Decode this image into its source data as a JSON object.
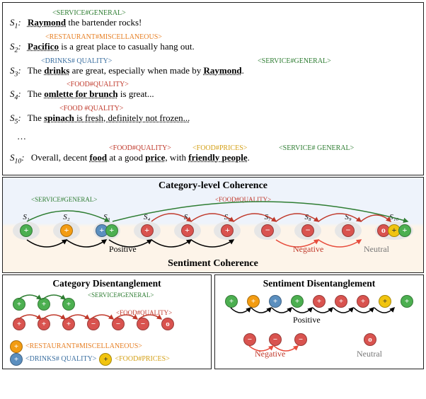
{
  "tags": {
    "service_general": "<SERVICE#GENERAL>",
    "restaurant_misc": "<RESTAURANT#MISCELLANEOUS>",
    "drinks_quality": "<DRINKS# QUALITY>",
    "food_quality": "<FOOD#QUALITY>",
    "food_quality_sp": "<FOOD #QUALITY>",
    "food_prices": "<FOOD#PRICES>",
    "service_general_sp": "<SERVICE# GENERAL>"
  },
  "sentences": {
    "s1": {
      "idx": "S",
      "sub": "1",
      "pre": "",
      "aspect": "Raymond",
      "post": " the bartender rocks!"
    },
    "s2": {
      "idx": "S",
      "sub": "2",
      "pre": "",
      "aspect": "Pacifico",
      "post": " is a great place to casually hang out."
    },
    "s3": {
      "idx": "S",
      "sub": "3",
      "pre": "The ",
      "aspect": "drinks",
      "post": " are great, especially when made by ",
      "aspect2": "Raymond",
      "post2": "."
    },
    "s4": {
      "idx": "S",
      "sub": "4",
      "pre": "The ",
      "aspect": "omlette for brunch",
      "post": " is great..."
    },
    "s5": {
      "idx": "S",
      "sub": "5",
      "pre": "The ",
      "aspect": "spinach",
      "post": " is fresh, definitely not frozen..."
    },
    "ell": "…",
    "s10": {
      "idx": "S",
      "sub": "10",
      "pre": "Overall, decent ",
      "aspect": "food",
      "mid1": " at a good ",
      "aspect2": "price",
      "mid2": ", with ",
      "aspect3": "friendly people",
      "post": "."
    }
  },
  "panel2": {
    "title_top": "Category-level Coherence",
    "title_bottom": "Sentiment Coherence",
    "tag_service": "<SERVICE#GENERAL>",
    "tag_food": "<FOOD#QUALITY>",
    "pos": "Positive",
    "neg": "Negative",
    "neu": "Neutral",
    "nodes": [
      "S₁",
      "S₂",
      "S₃",
      "S₄",
      "S₅",
      "S₆",
      "S₇",
      "S₈",
      "S₉",
      "S₁₀"
    ]
  },
  "panel3a": {
    "title": "Category Disentanglement",
    "legend_rm": "<RESTAURANT#MISCELLANEOUS>",
    "legend_dq": "<DRINKS# QUALITY>",
    "legend_fp": "<FOOD#PRICES>",
    "tag_service": "<SERVICE#GENERAL>",
    "tag_food": "<FOOD#QUALITY>"
  },
  "panel3b": {
    "title": "Sentiment Disentanglement",
    "pos": "Positive",
    "neg": "Negative",
    "neu": "Neutral"
  },
  "chart_data": {
    "type": "diagram",
    "sentence_aspects": [
      {
        "sentence": "S1",
        "aspects": [
          {
            "term": "Raymond",
            "category": "SERVICE#GENERAL",
            "sentiment": "positive"
          }
        ]
      },
      {
        "sentence": "S2",
        "aspects": [
          {
            "term": "Pacifico",
            "category": "RESTAURANT#MISCELLANEOUS",
            "sentiment": "positive"
          }
        ]
      },
      {
        "sentence": "S3",
        "aspects": [
          {
            "term": "drinks",
            "category": "DRINKS#QUALITY",
            "sentiment": "positive"
          },
          {
            "term": "Raymond",
            "category": "SERVICE#GENERAL",
            "sentiment": "positive"
          }
        ]
      },
      {
        "sentence": "S4",
        "aspects": [
          {
            "term": "omlette for brunch",
            "category": "FOOD#QUALITY",
            "sentiment": "positive"
          }
        ]
      },
      {
        "sentence": "S5",
        "aspects": [
          {
            "term": "spinach",
            "category": "FOOD#QUALITY",
            "sentiment": "positive"
          }
        ]
      },
      {
        "sentence": "S10",
        "aspects": [
          {
            "term": "food",
            "category": "FOOD#QUALITY",
            "sentiment": "neutral"
          },
          {
            "term": "price",
            "category": "FOOD#PRICES",
            "sentiment": "positive"
          },
          {
            "term": "friendly people",
            "category": "SERVICE#GENERAL",
            "sentiment": "positive"
          }
        ]
      }
    ],
    "coherence_nodes": [
      {
        "id": "S1",
        "sentiment": "positive",
        "color": "green"
      },
      {
        "id": "S2",
        "sentiment": "positive",
        "color": "orange"
      },
      {
        "id": "S3",
        "sentiment": "positive",
        "color": "blue",
        "also": "green"
      },
      {
        "id": "S4",
        "sentiment": "positive",
        "color": "red"
      },
      {
        "id": "S5",
        "sentiment": "positive",
        "color": "red"
      },
      {
        "id": "S6",
        "sentiment": "positive",
        "color": "red"
      },
      {
        "id": "S7",
        "sentiment": "negative",
        "color": "red"
      },
      {
        "id": "S8",
        "sentiment": "negative",
        "color": "red"
      },
      {
        "id": "S9",
        "sentiment": "negative",
        "color": "red"
      },
      {
        "id": "S10",
        "sentiment": "neutral",
        "color": "red",
        "also": [
          "yellow",
          "green"
        ]
      }
    ],
    "category_coherence_edges": [
      [
        "S1",
        "S3",
        "SERVICE#GENERAL"
      ],
      [
        "S3",
        "S10",
        "SERVICE#GENERAL"
      ],
      [
        "S4",
        "S5",
        "FOOD#QUALITY"
      ],
      [
        "S5",
        "S6",
        "FOOD#QUALITY"
      ],
      [
        "S6",
        "S7",
        "FOOD#QUALITY"
      ],
      [
        "S7",
        "S8",
        "FOOD#QUALITY"
      ],
      [
        "S8",
        "S9",
        "FOOD#QUALITY"
      ],
      [
        "S9",
        "S10",
        "FOOD#QUALITY"
      ]
    ],
    "sentiment_coherence_edges": [
      [
        "S1",
        "S2",
        "positive"
      ],
      [
        "S2",
        "S3",
        "positive"
      ],
      [
        "S3",
        "S4",
        "positive"
      ],
      [
        "S4",
        "S5",
        "positive"
      ],
      [
        "S5",
        "S6",
        "positive"
      ],
      [
        "S7",
        "S8",
        "negative"
      ],
      [
        "S8",
        "S9",
        "negative"
      ]
    ],
    "category_disentanglement": {
      "SERVICE#GENERAL": [
        "+",
        "+",
        "+"
      ],
      "FOOD#QUALITY": [
        "+",
        "+",
        "+",
        "-",
        "-",
        "-",
        "o"
      ],
      "RESTAURANT#MISCELLANEOUS": [
        "+"
      ],
      "DRINKS#QUALITY": [
        "+"
      ],
      "FOOD#PRICES": [
        "+"
      ]
    },
    "sentiment_disentanglement": {
      "positive": [
        "green",
        "orange",
        "blue",
        "green",
        "red",
        "red",
        "red",
        "yellow",
        "green"
      ],
      "negative": [
        "red",
        "red",
        "red"
      ],
      "neutral": [
        "red"
      ]
    }
  }
}
